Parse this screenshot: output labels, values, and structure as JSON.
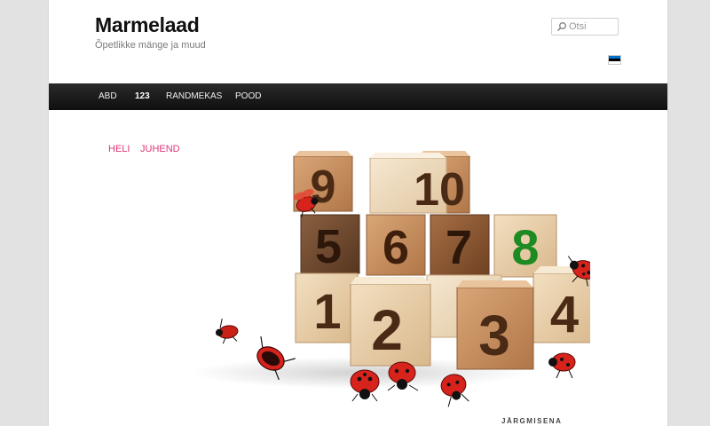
{
  "header": {
    "title": "Marmelaad",
    "tagline": "Õpetlikke mänge ja muud"
  },
  "search": {
    "placeholder": "Otsi"
  },
  "language_flag": {
    "colors": [
      "#0072ce",
      "#000000",
      "#ffffff"
    ]
  },
  "nav": {
    "items": [
      {
        "label": "ABD"
      },
      {
        "label": "123",
        "current": true
      },
      {
        "label": "RANDMEKAS"
      },
      {
        "label": "POOD"
      }
    ]
  },
  "game": {
    "links": [
      "HELI",
      "JUHEND"
    ],
    "blocks": [
      "9",
      "10",
      "5",
      "6",
      "7",
      "8",
      "1",
      "2",
      "3",
      "4"
    ],
    "highlight_block": "8",
    "next_label": "JÄRGMISENA"
  },
  "colors": {
    "nav_bg": "#1a1a1a",
    "link_pink": "#e0357a",
    "highlight_green": "#1d8a22",
    "ladybug_red": "#d8231c"
  }
}
